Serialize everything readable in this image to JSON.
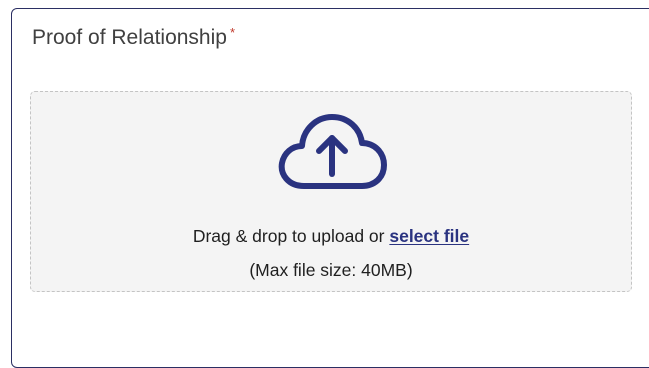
{
  "field": {
    "label": "Proof of Relationship",
    "required_marker": "*"
  },
  "upload": {
    "icon": "cloud-upload-icon",
    "prompt_text": "Drag & drop to upload or ",
    "select_link": "select file",
    "max_size_note": "(Max file size: 40MB)"
  },
  "colors": {
    "accent": "#2a3380",
    "border": "#2b2f63",
    "required": "#c0392b",
    "dropzone_bg": "#f4f4f4"
  }
}
